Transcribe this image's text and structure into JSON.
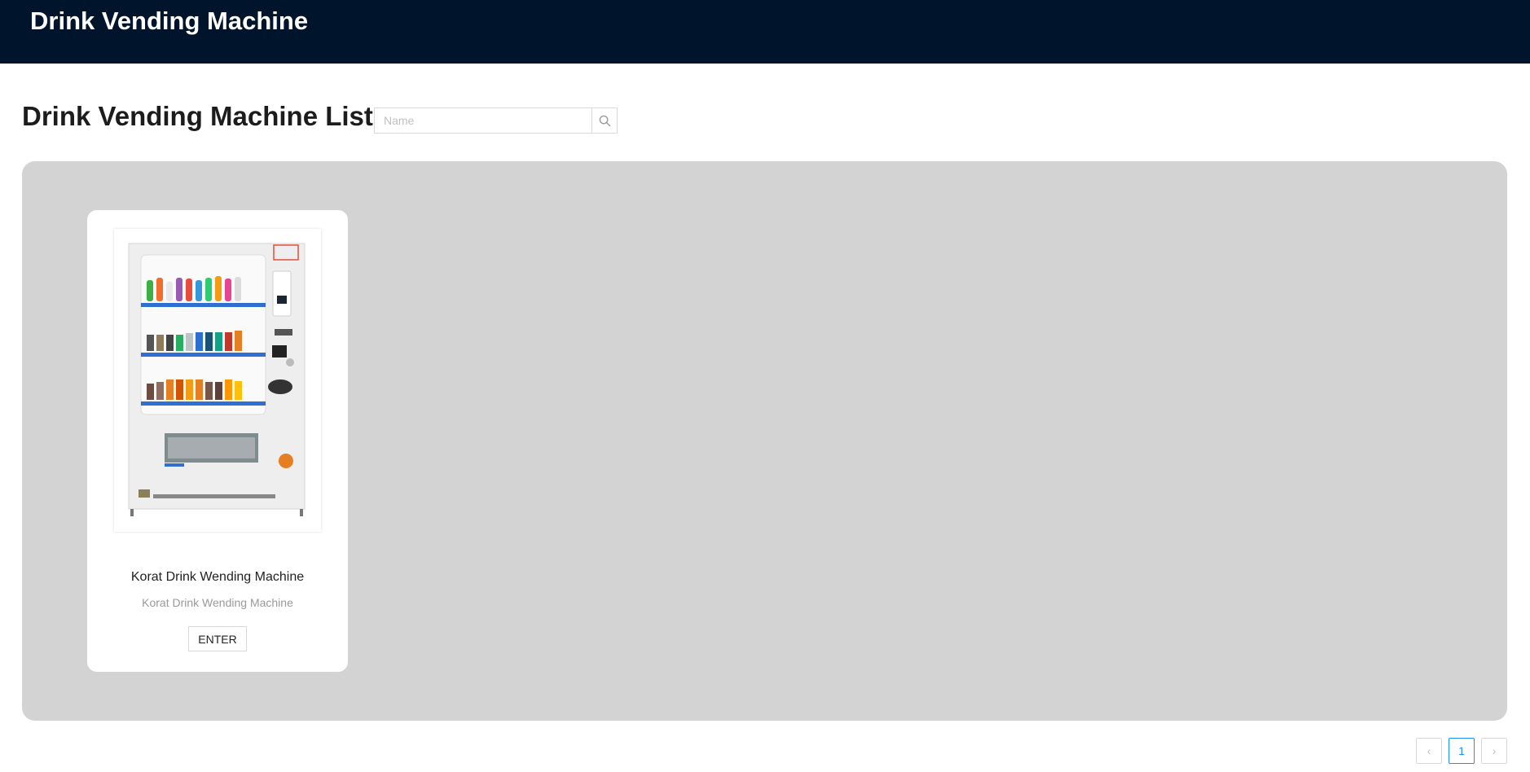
{
  "header": {
    "title": "Drink Vending Machine"
  },
  "page": {
    "title": "Drink Vending Machine List"
  },
  "search": {
    "placeholder": "Name",
    "value": "",
    "icon": "search-icon"
  },
  "machines": [
    {
      "name": "Korat Drink Wending Machine",
      "description": "Korat Drink Wending Machine",
      "button_label": "ENTER"
    }
  ],
  "pagination": {
    "prev_icon": "‹",
    "current_page": "1",
    "next_icon": "›"
  },
  "colors": {
    "header_bg": "#00152b",
    "panel_bg": "#d3d3d3",
    "accent": "#1890ff"
  }
}
